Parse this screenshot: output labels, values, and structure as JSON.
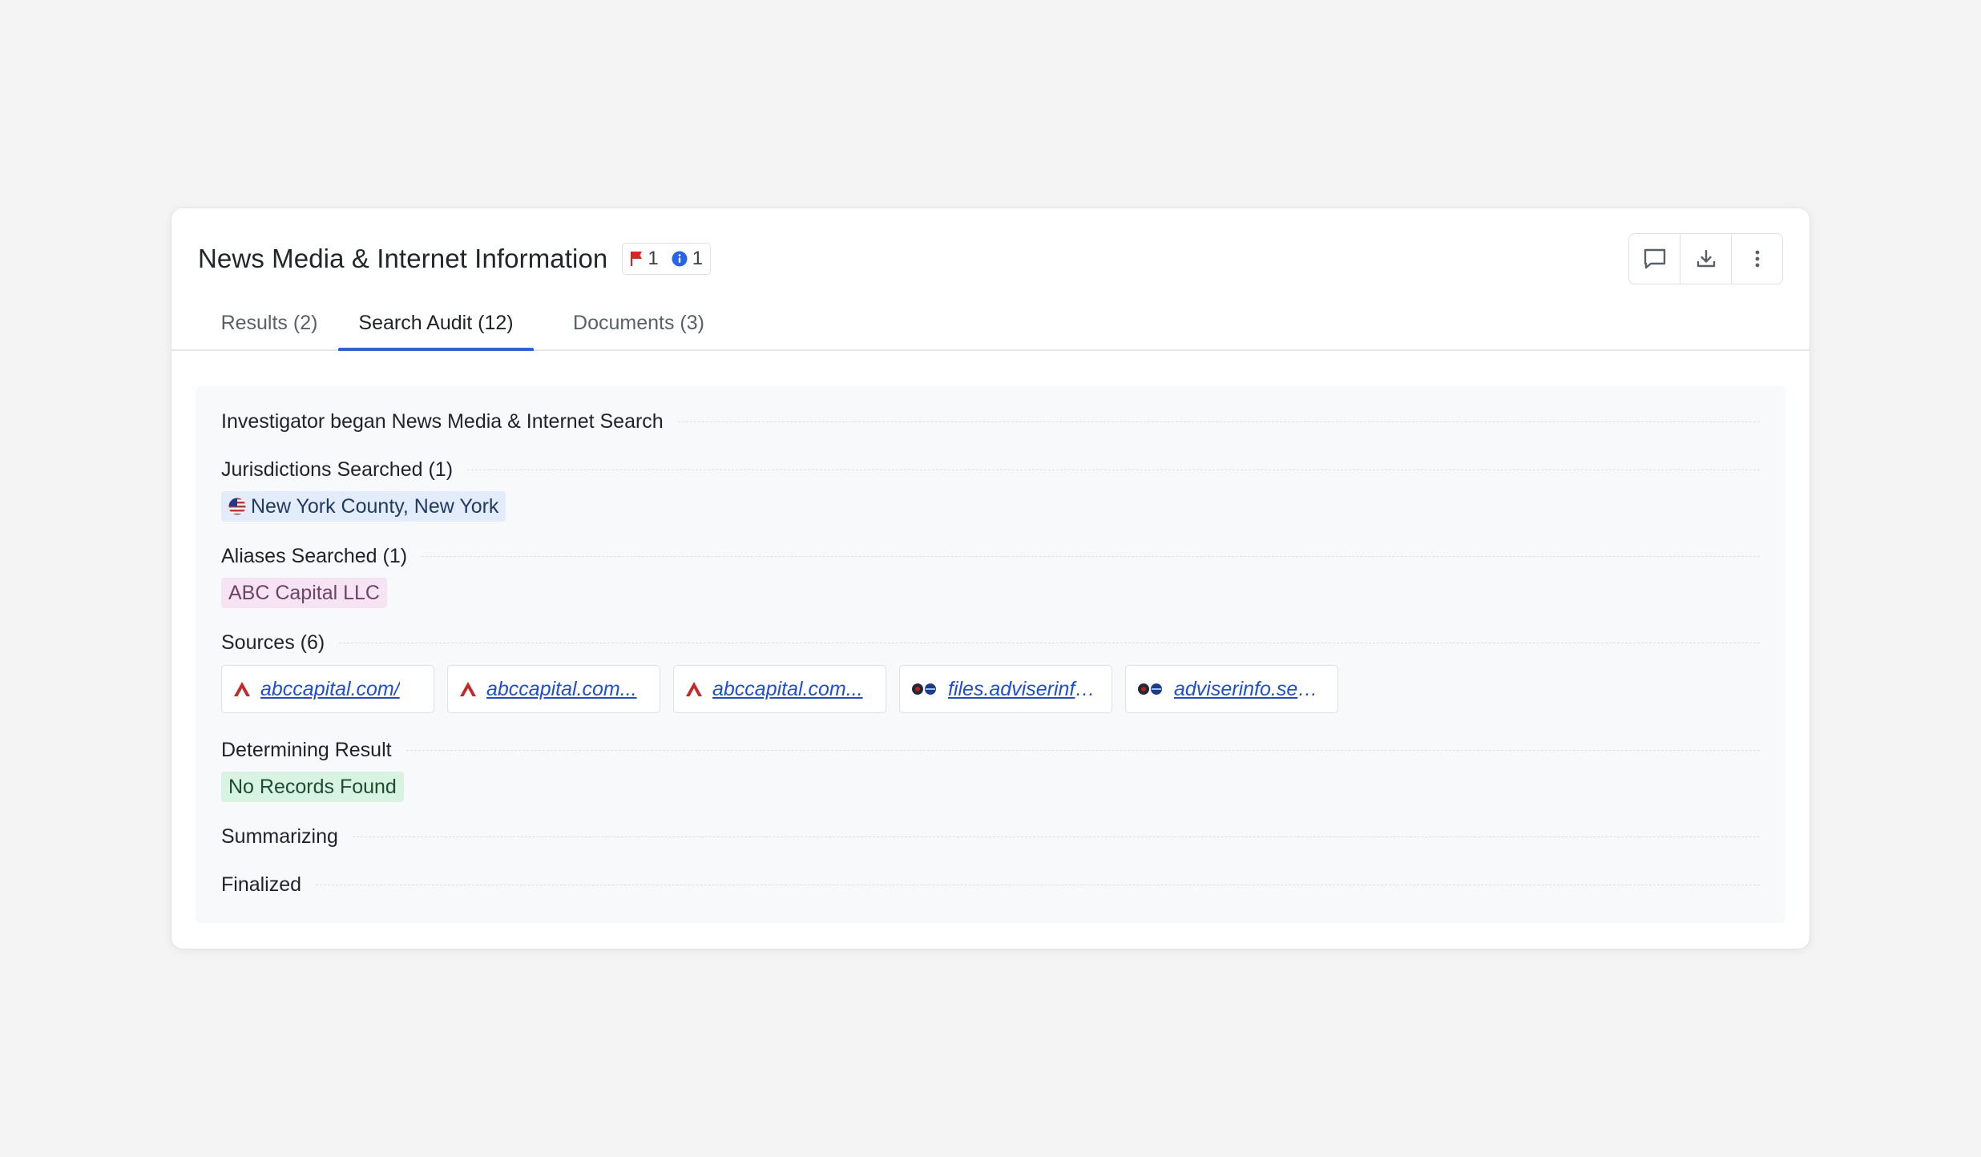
{
  "header": {
    "title": "News Media & Internet Information",
    "flag_count": "1",
    "info_count": "1"
  },
  "tabs": [
    {
      "label": "Results (2)"
    },
    {
      "label": "Search Audit (12)"
    },
    {
      "label": "Documents (3)"
    }
  ],
  "audit": {
    "began": "Investigator began News Media & Internet Search",
    "jurisdictions_label": "Jurisdictions Searched (1)",
    "jurisdiction": "New York County, New York",
    "aliases_label": "Aliases Searched (1)",
    "alias": "ABC Capital LLC",
    "sources_label": "Sources (6)",
    "sources": [
      {
        "text": "abccapital.com/",
        "icon": "abc-capital-logo-icon"
      },
      {
        "text": "abccapital.com...",
        "icon": "abc-capital-logo-icon"
      },
      {
        "text": "abccapital.com...",
        "icon": "abc-capital-logo-icon"
      },
      {
        "text": "files.adviserinfo...",
        "icon": "sec-logo-icon"
      },
      {
        "text": "adviserinfo.sec....",
        "icon": "sec-logo-icon"
      }
    ],
    "result_label": "Determining Result",
    "result": "No Records Found",
    "summarizing_label": "Summarizing",
    "finalized_label": "Finalized"
  },
  "colors": {
    "accent": "#2563eb",
    "flag": "#dc2626",
    "info": "#2563eb",
    "link": "#1d4ed8"
  }
}
